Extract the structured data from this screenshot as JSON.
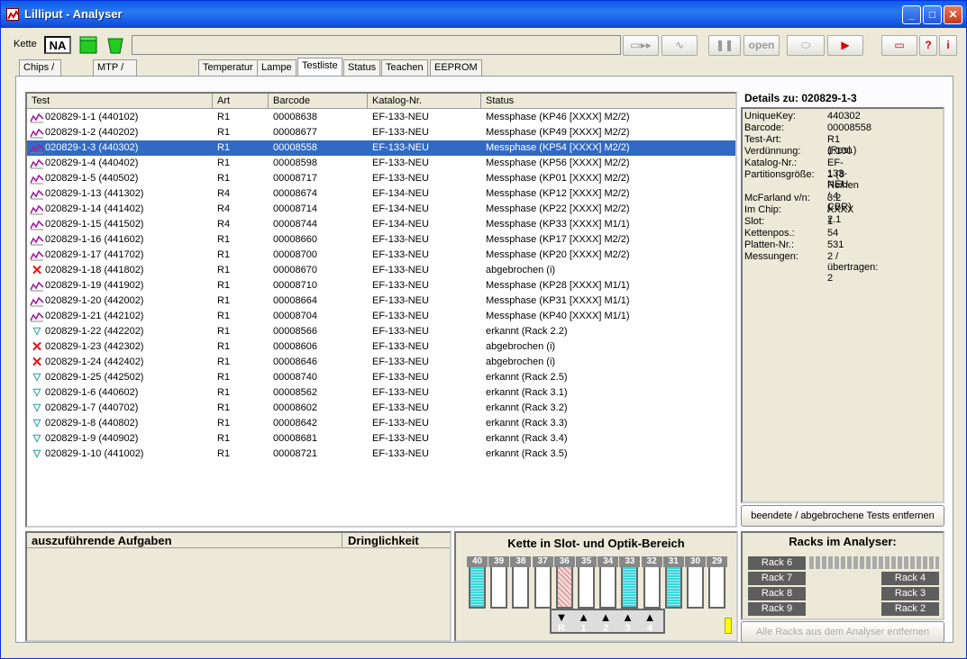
{
  "window": {
    "title": "Lilliput - Analyser"
  },
  "toolbar": {
    "kette_label": "Kette",
    "kette_value": "NA",
    "open_label": "open"
  },
  "tabs": [
    "Chips / Spitzen",
    "MTP / NaCl / Bouillon",
    "Temperatur",
    "Lampe",
    "Testliste",
    "Status",
    "Teachen",
    "EEPROM"
  ],
  "grid": {
    "headers": [
      "Test",
      "Art",
      "Barcode",
      "Katalog-Nr.",
      "Status"
    ],
    "rows": [
      {
        "icon": "chart",
        "test": "020829-1-1 (440102)",
        "art": "R1",
        "barcode": "00008638",
        "kat": "EF-133-NEU",
        "status": "Messphase (KP46 [XXXX] M2/2)"
      },
      {
        "icon": "chart",
        "test": "020829-1-2 (440202)",
        "art": "R1",
        "barcode": "00008677",
        "kat": "EF-133-NEU",
        "status": "Messphase (KP49 [XXXX] M2/2)"
      },
      {
        "icon": "chart",
        "test": "020829-1-3 (440302)",
        "art": "R1",
        "barcode": "00008558",
        "kat": "EF-133-NEU",
        "status": "Messphase (KP54 [XXXX] M2/2)"
      },
      {
        "icon": "chart",
        "test": "020829-1-4 (440402)",
        "art": "R1",
        "barcode": "00008598",
        "kat": "EF-133-NEU",
        "status": "Messphase (KP56 [XXXX] M2/2)"
      },
      {
        "icon": "chart",
        "test": "020829-1-5 (440502)",
        "art": "R1",
        "barcode": "00008717",
        "kat": "EF-133-NEU",
        "status": "Messphase (KP01 [XXXX] M2/2)"
      },
      {
        "icon": "chart",
        "test": "020829-1-13 (441302)",
        "art": "R4",
        "barcode": "00008674",
        "kat": "EF-134-NEU",
        "status": "Messphase (KP12 [XXXX] M2/2)"
      },
      {
        "icon": "chart",
        "test": "020829-1-14 (441402)",
        "art": "R4",
        "barcode": "00008714",
        "kat": "EF-134-NEU",
        "status": "Messphase (KP22 [XXXX] M2/2)"
      },
      {
        "icon": "chart",
        "test": "020829-1-15 (441502)",
        "art": "R4",
        "barcode": "00008744",
        "kat": "EF-134-NEU",
        "status": "Messphase (KP33 [XXXX] M1/1)"
      },
      {
        "icon": "chart",
        "test": "020829-1-16 (441602)",
        "art": "R1",
        "barcode": "00008660",
        "kat": "EF-133-NEU",
        "status": "Messphase (KP17 [XXXX] M2/2)"
      },
      {
        "icon": "chart",
        "test": "020829-1-17 (441702)",
        "art": "R1",
        "barcode": "00008700",
        "kat": "EF-133-NEU",
        "status": "Messphase (KP20 [XXXX] M2/2)"
      },
      {
        "icon": "x",
        "test": "020829-1-18 (441802)",
        "art": "R1",
        "barcode": "00008670",
        "kat": "EF-133-NEU",
        "status": "abgebrochen (i)"
      },
      {
        "icon": "chart",
        "test": "020829-1-19 (441902)",
        "art": "R1",
        "barcode": "00008710",
        "kat": "EF-133-NEU",
        "status": "Messphase (KP28 [XXXX] M1/1)"
      },
      {
        "icon": "chart",
        "test": "020829-1-20 (442002)",
        "art": "R1",
        "barcode": "00008664",
        "kat": "EF-133-NEU",
        "status": "Messphase (KP31 [XXXX] M1/1)"
      },
      {
        "icon": "chart",
        "test": "020829-1-21 (442102)",
        "art": "R1",
        "barcode": "00008704",
        "kat": "EF-133-NEU",
        "status": "Messphase (KP40 [XXXX] M1/1)"
      },
      {
        "icon": "tube",
        "test": "020829-1-22 (442202)",
        "art": "R1",
        "barcode": "00008566",
        "kat": "EF-133-NEU",
        "status": "erkannt (Rack 2.2)"
      },
      {
        "icon": "x",
        "test": "020829-1-23 (442302)",
        "art": "R1",
        "barcode": "00008606",
        "kat": "EF-133-NEU",
        "status": "abgebrochen (i)"
      },
      {
        "icon": "x",
        "test": "020829-1-24 (442402)",
        "art": "R1",
        "barcode": "00008646",
        "kat": "EF-133-NEU",
        "status": "abgebrochen (i)"
      },
      {
        "icon": "tube",
        "test": "020829-1-25 (442502)",
        "art": "R1",
        "barcode": "00008740",
        "kat": "EF-133-NEU",
        "status": "erkannt (Rack 2.5)"
      },
      {
        "icon": "tube",
        "test": "020829-1-6 (440602)",
        "art": "R1",
        "barcode": "00008562",
        "kat": "EF-133-NEU",
        "status": "erkannt (Rack 3.1)"
      },
      {
        "icon": "tube",
        "test": "020829-1-7 (440702)",
        "art": "R1",
        "barcode": "00008602",
        "kat": "EF-133-NEU",
        "status": "erkannt (Rack 3.2)"
      },
      {
        "icon": "tube",
        "test": "020829-1-8 (440802)",
        "art": "R1",
        "barcode": "00008642",
        "kat": "EF-133-NEU",
        "status": "erkannt (Rack 3.3)"
      },
      {
        "icon": "tube",
        "test": "020829-1-9 (440902)",
        "art": "R1",
        "barcode": "00008681",
        "kat": "EF-133-NEU",
        "status": "erkannt (Rack 3.4)"
      },
      {
        "icon": "tube",
        "test": "020829-1-10 (441002)",
        "art": "R1",
        "barcode": "00008721",
        "kat": "EF-133-NEU",
        "status": "erkannt (Rack 3.5)"
      }
    ],
    "selected_index": 2
  },
  "details": {
    "title": "Details zu: 020829-1-3",
    "items": [
      {
        "k": "UniqueKey:",
        "v": "440302"
      },
      {
        "k": "Barcode:",
        "v": "00008558"
      },
      {
        "k": "Test-Art:",
        "v": "R1 (Resi.)"
      },
      {
        "k": "Verdünnung:",
        "v": "1:100"
      },
      {
        "k": "Katalog-Nr.:",
        "v": "EF-133-NEU"
      },
      {
        "k": "Partitionsgröße:",
        "v": "1 (8 Reihen / 4 CBR)"
      },
      {
        "k": "",
        "v": ""
      },
      {
        "k": "McFarland v/n:",
        "v": "3.2 / 2.1"
      },
      {
        "k": "Im Chip:",
        "v": "XXXX"
      },
      {
        "k": "Slot:",
        "v": "1"
      },
      {
        "k": "Kettenpos.:",
        "v": "54"
      },
      {
        "k": "Platten-Nr.:",
        "v": "531"
      },
      {
        "k": "Messungen:",
        "v": "2 / übertragen:    2"
      }
    ],
    "remove_button": "beendete / abgebrochene Tests entfernen"
  },
  "tasks": {
    "col1": "auszuführende Aufgaben",
    "col2": "Dringlichkeit"
  },
  "chain": {
    "title": "Kette in Slot- und Optik-Bereich",
    "slots": [
      "40",
      "39",
      "38",
      "37",
      "36",
      "35",
      "34",
      "33",
      "32",
      "31",
      "30",
      "29"
    ],
    "positions": [
      "R",
      "1",
      "2",
      "3",
      "4"
    ]
  },
  "racks": {
    "title": "Racks im Analyser:",
    "left": [
      "Rack 6",
      "Rack 7",
      "Rack 8",
      "Rack 9"
    ],
    "right": [
      "Rack 4",
      "Rack 3",
      "Rack 2"
    ],
    "remove_button": "Alle Racks aus dem Analyser entfernen"
  }
}
